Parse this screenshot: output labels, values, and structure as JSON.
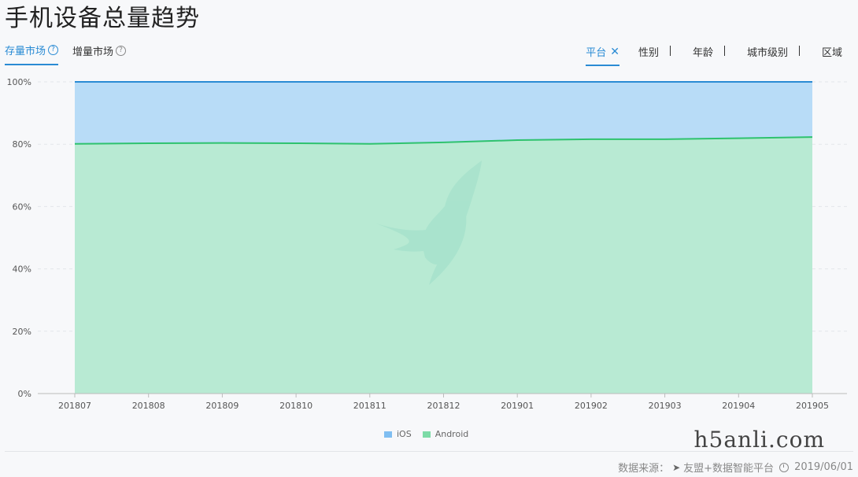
{
  "page": {
    "title": "手机设备总量趋势"
  },
  "tabs_left": [
    {
      "label": "存量市场",
      "active": true
    },
    {
      "label": "增量市场",
      "active": false
    }
  ],
  "tabs_right": [
    {
      "label": "平台",
      "active": true
    },
    {
      "label": "性别",
      "active": false
    },
    {
      "label": "年龄",
      "active": false
    },
    {
      "label": "城市级别",
      "active": false
    },
    {
      "label": "区域",
      "active": false
    }
  ],
  "icons": {
    "help": "question-circle-icon",
    "close": "close-icon",
    "source": "paper-plane-icon",
    "date": "clock-icon"
  },
  "chart_data": {
    "type": "area",
    "stacked": true,
    "percent": true,
    "categories": [
      "201807",
      "201808",
      "201809",
      "201810",
      "201811",
      "201812",
      "201901",
      "201902",
      "201903",
      "201904",
      "201905"
    ],
    "series": [
      {
        "name": "Android",
        "color": "#b8ead3",
        "line_color": "#2ec26e",
        "values": [
          80.1,
          80.3,
          80.4,
          80.3,
          80.1,
          80.6,
          81.3,
          81.6,
          81.6,
          81.9,
          82.3
        ]
      },
      {
        "name": "iOS",
        "color": "#b8dcf7",
        "line_color": "#2a8bd4",
        "values": [
          19.9,
          19.7,
          19.6,
          19.7,
          19.9,
          19.4,
          18.7,
          18.4,
          18.4,
          18.1,
          17.7
        ]
      }
    ],
    "yticks": [
      "0%",
      "20%",
      "40%",
      "60%",
      "80%",
      "100%"
    ],
    "ylim": [
      0,
      100
    ],
    "legend": {
      "position": "bottom",
      "items": [
        {
          "label": "iOS",
          "color": "#7fbef1"
        },
        {
          "label": "Android",
          "color": "#7ddba7"
        }
      ]
    }
  },
  "watermark": "h5anli.com",
  "footer": {
    "source_label": "数据来源：",
    "source": "友盟+数据智能平台",
    "date": "2019/06/01"
  }
}
